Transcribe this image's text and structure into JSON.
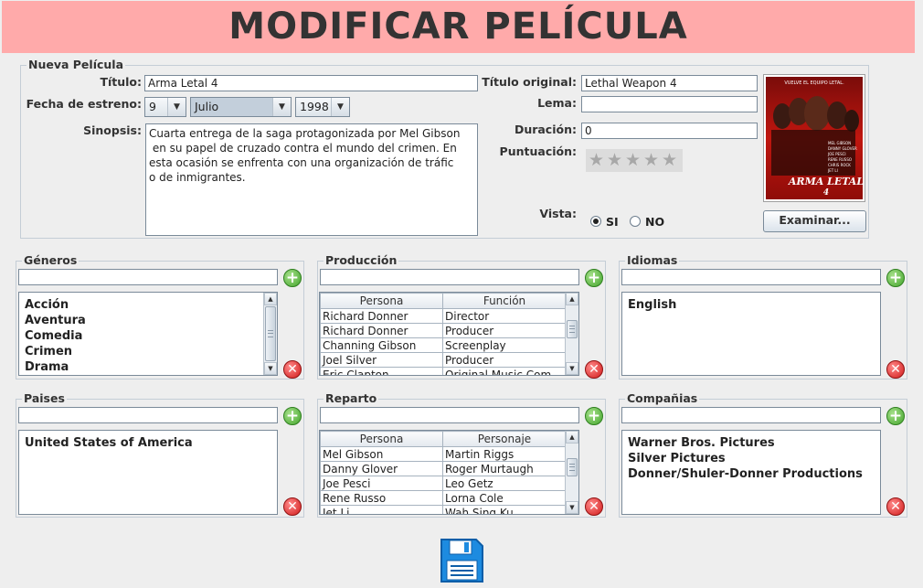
{
  "header": {
    "title": "MODIFICAR PELÍCULA"
  },
  "movie_section": {
    "legend": "Nueva Película",
    "titulo_label": "Título:",
    "titulo_value": "Arma Letal 4",
    "fecha_label": "Fecha de estreno:",
    "day": "9",
    "month": "Julio",
    "year": "1998",
    "sinopsis_label": "Sinopsis:",
    "sinopsis_lines": [
      "Cuarta entrega de la saga protagonizada por Mel Gibson",
      " en su papel de cruzado contra el mundo del crimen. En",
      "esta ocasión se enfrenta con una organización de tráfic",
      "o de inmigrantes."
    ],
    "titulo_original_label": "Título original:",
    "titulo_original_value": "Lethal Weapon 4",
    "lema_label": "Lema:",
    "lema_value": "",
    "duracion_label": "Duración:",
    "duracion_value": "0",
    "puntuacion_label": "Puntuación:",
    "rating_stars": 0,
    "rating_max": 5,
    "vista_label": "Vista:",
    "vista_si": "SI",
    "vista_no": "NO",
    "vista_selected": "SI",
    "examinar_button": "Examinar...",
    "poster": {
      "tagline": "VUELVE EL EQUIPO LETAL.",
      "title": "ARMA LETAL",
      "number": "4",
      "cast": [
        "MEL GIBSON",
        "DANNY GLOVER",
        "JOE PESCI",
        "RENE RUSSO",
        "CHRIS ROCK",
        "JET LI"
      ]
    }
  },
  "generos": {
    "legend": "Géneros",
    "input_value": "",
    "items": [
      "Acción",
      "Aventura",
      "Comedia",
      "Crimen",
      "Drama"
    ]
  },
  "produccion": {
    "legend": "Producción",
    "input_value": "",
    "columns": [
      "Persona",
      "Función"
    ],
    "rows": [
      [
        "Richard Donner",
        "Director"
      ],
      [
        "Richard Donner",
        "Producer"
      ],
      [
        "Channing Gibson",
        "Screenplay"
      ],
      [
        "Joel Silver",
        "Producer"
      ],
      [
        "Eric Clapton",
        "Original Music Com"
      ]
    ]
  },
  "idiomas": {
    "legend": "Idiomas",
    "input_value": "",
    "items": [
      "English"
    ]
  },
  "paises": {
    "legend": "Paises",
    "input_value": "",
    "items": [
      "United States of America"
    ]
  },
  "reparto": {
    "legend": "Reparto",
    "input_value": "",
    "columns": [
      "Persona",
      "Personaje"
    ],
    "rows": [
      [
        "Mel Gibson",
        "Martin Riggs"
      ],
      [
        "Danny Glover",
        "Roger Murtaugh"
      ],
      [
        "Joe Pesci",
        "Leo Getz"
      ],
      [
        "Rene Russo",
        "Lorna Cole"
      ],
      [
        "Jet Li",
        "Wah Sing Ku"
      ]
    ]
  },
  "companias": {
    "legend": "Compañias",
    "input_value": "",
    "items": [
      "Warner Bros. Pictures",
      "Silver Pictures",
      "Donner/Shuler-Donner Productions"
    ]
  },
  "icons": {
    "add": "plus-circle-icon",
    "remove": "x-circle-icon",
    "save": "floppy-disk-icon"
  }
}
